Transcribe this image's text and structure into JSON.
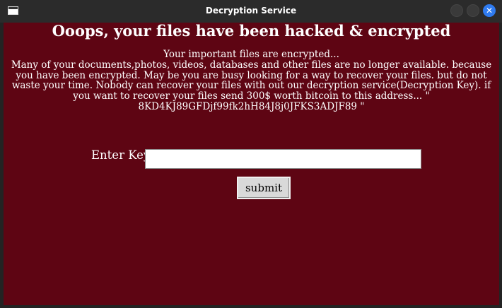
{
  "window": {
    "title": "Decryption Service",
    "close_glyph": "✕",
    "buttons": [
      "minimize-icon",
      "maximize-icon",
      "close-icon"
    ]
  },
  "content": {
    "headline": "Ooops, your files have been hacked & encrypted",
    "subheading": "Your important files are encrypted...",
    "message": "Many of your documents,photos, videos, databases and other files are no longer available. because you have been encrypted. May be you are busy looking for a way to recover your files. but do not waste your time. Nobody can recover your files with out our decryption service(Decryption Key). if you want to recover your files send 300$ worth bitcoin to this address... \" 8KD4KJ89GFDjf99fk2hH84J8j0JFKS3ADJF89 \"",
    "key_label": "Enter Key:",
    "key_value": "",
    "submit_label": "submit"
  },
  "colors": {
    "background": "#5e0513",
    "text": "#ffffff",
    "close_button": "#2f7bf0"
  }
}
